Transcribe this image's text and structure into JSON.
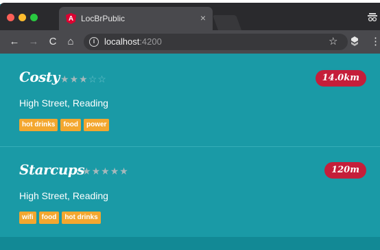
{
  "browser": {
    "tab_title": "LocBrPublic",
    "tab_close": "×",
    "url_host": "localhost",
    "url_port": ":4200",
    "icons": {
      "back": "back-arrow-icon",
      "forward": "forward-arrow-icon",
      "reload": "reload-icon",
      "home": "home-icon",
      "info": "info-icon",
      "bookmark": "bookmark-star-icon",
      "extension": "extension-icon",
      "menu": "menu-icon",
      "favicon": "angular-favicon-icon",
      "profile": "incognito-profile-icon"
    },
    "glyphs": {
      "back": "←",
      "forward": "→",
      "reload": "C",
      "home": "⌂",
      "info": "i",
      "bookmark": "☆",
      "menu": "⋮",
      "favicon": "A"
    }
  },
  "colors": {
    "page_background": "#1a9aa6",
    "distance_badge": "#c51e3a",
    "tag": "#f3a72f"
  },
  "locations": [
    {
      "name": "Costy",
      "rating": 3,
      "rating_max": 5,
      "distance": "14.0km",
      "address": "High Street, Reading",
      "facilities": [
        "hot drinks",
        "food",
        "power"
      ]
    },
    {
      "name": "Starcups",
      "rating": 5,
      "rating_max": 5,
      "distance": "120m",
      "address": "High Street, Reading",
      "facilities": [
        "wifi",
        "food",
        "hot drinks"
      ]
    }
  ]
}
